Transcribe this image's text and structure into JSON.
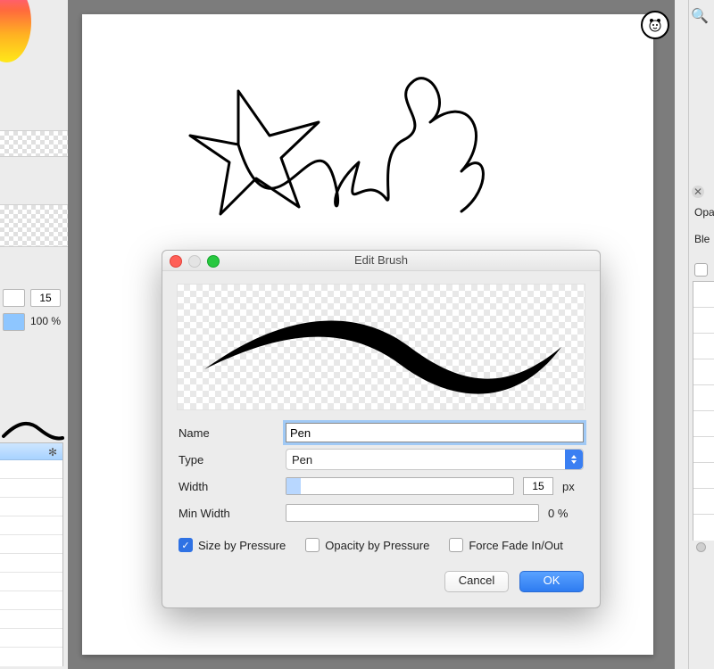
{
  "left": {
    "size_value": "15",
    "opacity_label": "100 %"
  },
  "right": {
    "opacity_label": "Opa",
    "blend_label": "Ble"
  },
  "dialog": {
    "title": "Edit Brush",
    "name_label": "Name",
    "name_value": "Pen",
    "type_label": "Type",
    "type_value": "Pen",
    "width_label": "Width",
    "width_value": "15",
    "width_unit": "px",
    "minwidth_label": "Min Width",
    "minwidth_value": "0 %",
    "check_size": "Size by Pressure",
    "check_opacity": "Opacity by Pressure",
    "check_fade": "Force Fade In/Out",
    "cancel": "Cancel",
    "ok": "OK"
  }
}
